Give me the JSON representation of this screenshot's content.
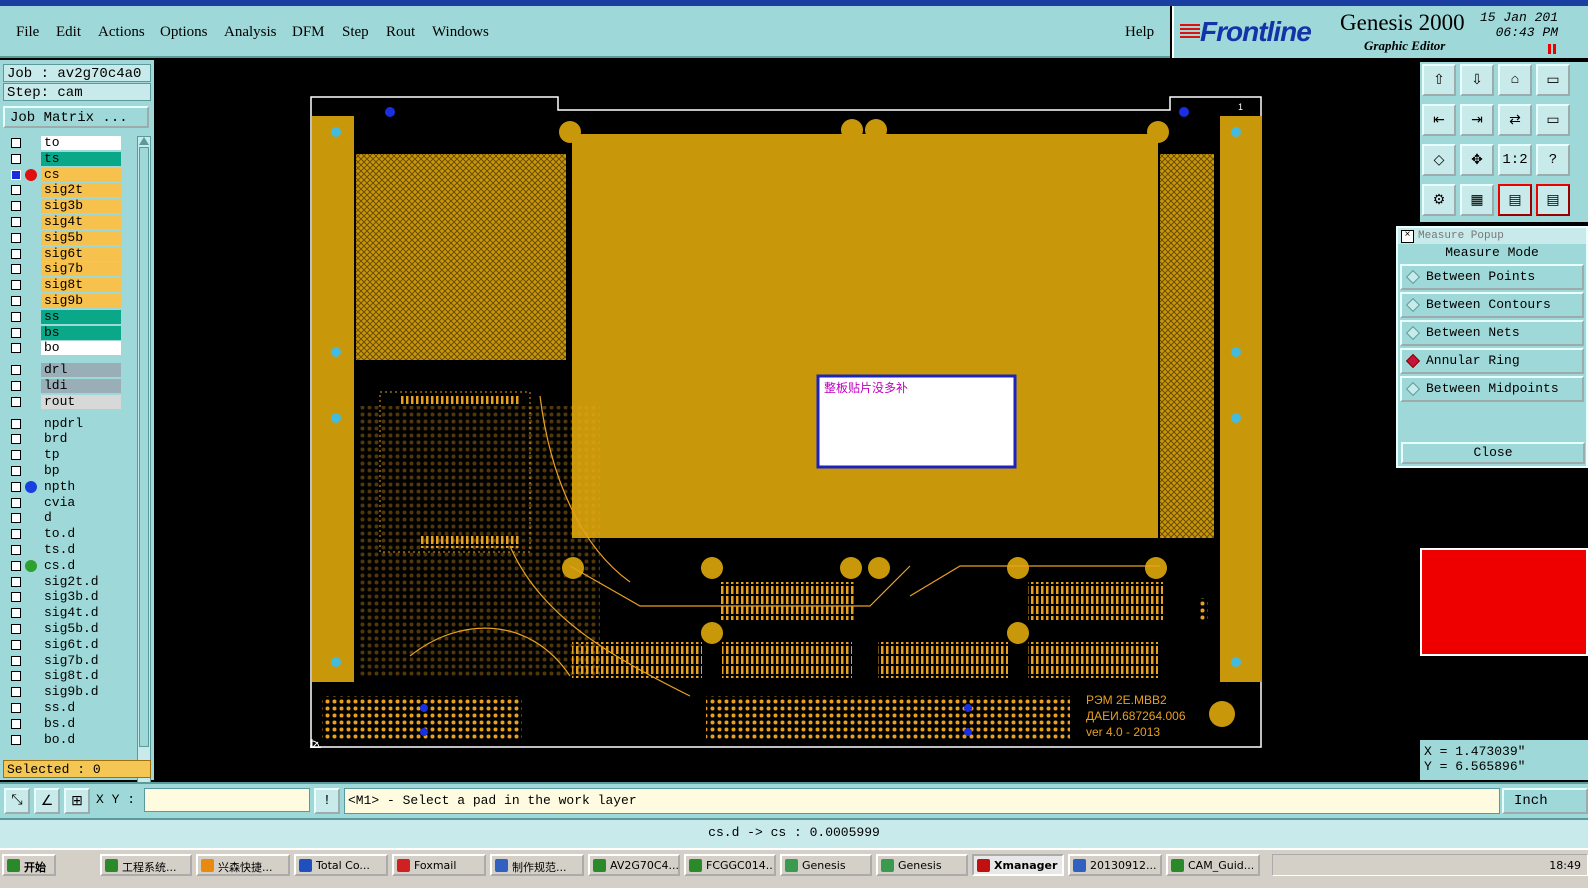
{
  "menu": {
    "items": [
      "File",
      "Edit",
      "Actions",
      "Options",
      "Analysis",
      "DFM",
      "Step",
      "Rout",
      "Windows"
    ],
    "help": "Help"
  },
  "brand": {
    "logo": "Frontline",
    "product": "Genesis 2000",
    "subtitle": "Graphic Editor",
    "date": "15 Jan 201",
    "time": "06:43 PM"
  },
  "job": {
    "job_label": "Job : av2g70c4a0",
    "step_label": "Step: cam",
    "matrix_button": "Job Matrix ..."
  },
  "layers": [
    {
      "name": "to",
      "color": "#ffffff",
      "dot": ""
    },
    {
      "name": "ts",
      "color": "#0aa888",
      "dot": ""
    },
    {
      "name": "cs",
      "color": "#f7c14d",
      "dot": "#e01010",
      "checked": true
    },
    {
      "name": "sig2t",
      "color": "#f7c14d",
      "dot": ""
    },
    {
      "name": "sig3b",
      "color": "#f7c14d",
      "dot": ""
    },
    {
      "name": "sig4t",
      "color": "#f7c14d",
      "dot": ""
    },
    {
      "name": "sig5b",
      "color": "#f7c14d",
      "dot": ""
    },
    {
      "name": "sig6t",
      "color": "#f7c14d",
      "dot": ""
    },
    {
      "name": "sig7b",
      "color": "#f7c14d",
      "dot": ""
    },
    {
      "name": "sig8t",
      "color": "#f7c14d",
      "dot": ""
    },
    {
      "name": "sig9b",
      "color": "#f7c14d",
      "dot": ""
    },
    {
      "name": "ss",
      "color": "#0aa888",
      "dot": ""
    },
    {
      "name": "bs",
      "color": "#0aa888",
      "dot": ""
    },
    {
      "name": "bo",
      "color": "#ffffff",
      "dot": ""
    },
    {
      "name": "drl",
      "color": "#9aaeb8",
      "dot": ""
    },
    {
      "name": "ldi",
      "color": "#9aaeb8",
      "dot": ""
    },
    {
      "name": "rout",
      "color": "#d8d8d8",
      "dot": ""
    },
    {
      "name": "npdrl",
      "color": "#9fd8d8",
      "dot": ""
    },
    {
      "name": "brd",
      "color": "#9fd8d8",
      "dot": ""
    },
    {
      "name": "tp",
      "color": "#9fd8d8",
      "dot": ""
    },
    {
      "name": "bp",
      "color": "#9fd8d8",
      "dot": ""
    },
    {
      "name": "npth",
      "color": "#9fd8d8",
      "dot": "#1a3fe0"
    },
    {
      "name": "cvia",
      "color": "#9fd8d8",
      "dot": ""
    },
    {
      "name": "d",
      "color": "#9fd8d8",
      "dot": ""
    },
    {
      "name": "to.d",
      "color": "#9fd8d8",
      "dot": ""
    },
    {
      "name": "ts.d",
      "color": "#9fd8d8",
      "dot": ""
    },
    {
      "name": "cs.d",
      "color": "#9fd8d8",
      "dot": "#2ea030"
    },
    {
      "name": "sig2t.d",
      "color": "#9fd8d8",
      "dot": ""
    },
    {
      "name": "sig3b.d",
      "color": "#9fd8d8",
      "dot": ""
    },
    {
      "name": "sig4t.d",
      "color": "#9fd8d8",
      "dot": ""
    },
    {
      "name": "sig5b.d",
      "color": "#9fd8d8",
      "dot": ""
    },
    {
      "name": "sig6t.d",
      "color": "#9fd8d8",
      "dot": ""
    },
    {
      "name": "sig7b.d",
      "color": "#9fd8d8",
      "dot": ""
    },
    {
      "name": "sig8t.d",
      "color": "#9fd8d8",
      "dot": ""
    },
    {
      "name": "sig9b.d",
      "color": "#9fd8d8",
      "dot": ""
    },
    {
      "name": "ss.d",
      "color": "#9fd8d8",
      "dot": ""
    },
    {
      "name": "bs.d",
      "color": "#9fd8d8",
      "dot": ""
    },
    {
      "name": "bo.d",
      "color": "#9fd8d8",
      "dot": ""
    }
  ],
  "selected_label": "Selected : 0",
  "board": {
    "note": "整板贴片没多补",
    "silk_line1": "РЭМ 2Е.МВВ2",
    "silk_line2": "ДАЕИ.687264.006",
    "silk_line3": "ver 4.0 - 2013",
    "corner_number": "1",
    "colors": {
      "copper": "#c8980a",
      "bg": "#000000",
      "pad": "#e8a020",
      "hole": "#1a2fe0",
      "hole_light": "#44bbdd"
    }
  },
  "toolbar_icons": [
    "open-up-icon",
    "save-down-icon",
    "home-icon",
    "grid-icon",
    "shift-left-icon",
    "shift-right-icon",
    "mirror-icon",
    "zoom-out-icon",
    "fit-icon",
    "pan-icon",
    "ratio-1-2-icon",
    "help-query-icon",
    "settings-icon",
    "snap-grid-icon",
    "layers-icon",
    "layers-red-icon"
  ],
  "toolbar_labels": {
    "ratio": "1:2",
    "help": "?"
  },
  "measure": {
    "title": "Measure Popup",
    "mode_label": "Measure Mode",
    "options": [
      "Between Points",
      "Between Contours",
      "Between Nets",
      "Annular Ring",
      "Between Midpoints"
    ],
    "selected": "Annular Ring",
    "close": "Close"
  },
  "coords": {
    "x": "X = 1.473039\"",
    "y": "Y = 6.565896\""
  },
  "command": {
    "xy_label": "X Y :",
    "xy_value": "",
    "prompt": "<M1> - Select a pad in the work layer",
    "unit": "Inch",
    "warn": "!"
  },
  "status": "cs.d -> cs : 0.0005999",
  "taskbar": {
    "start": "开始",
    "tasks": [
      "工程系统...",
      "兴森快捷...",
      "Total Co...",
      "Foxmail",
      "制作规范...",
      "AV2G70C4...",
      "FCGGC014...",
      "Genesis",
      "Genesis",
      "Xmanager",
      "20130912...",
      "CAM_Guid..."
    ],
    "active": "Xmanager",
    "clock": "18:49"
  }
}
